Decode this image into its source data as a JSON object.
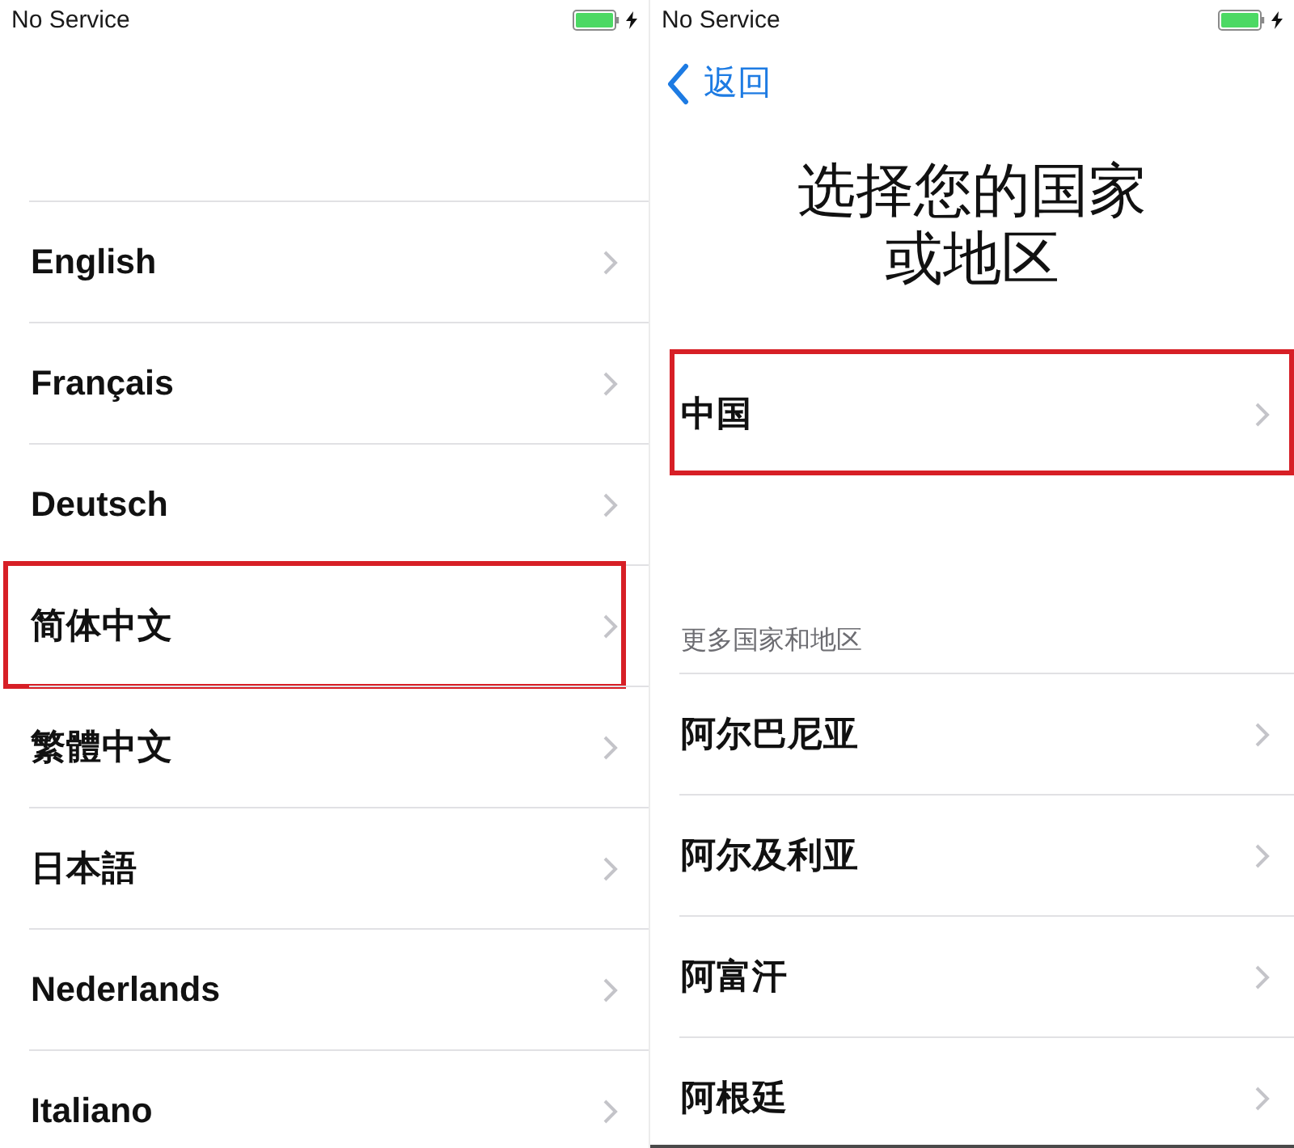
{
  "language_screen": {
    "status_bar": {
      "carrier": "No Service"
    },
    "languages": [
      {
        "label": "English",
        "highlighted": false
      },
      {
        "label": "Français",
        "highlighted": false
      },
      {
        "label": "Deutsch",
        "highlighted": false
      },
      {
        "label": "简体中文",
        "highlighted": true
      },
      {
        "label": "繁體中文",
        "highlighted": false
      },
      {
        "label": "日本語",
        "highlighted": false
      },
      {
        "label": "Nederlands",
        "highlighted": false
      },
      {
        "label": "Italiano",
        "highlighted": false
      }
    ]
  },
  "region_screen": {
    "status_bar": {
      "carrier": "No Service"
    },
    "back_button": {
      "label": "返回"
    },
    "title": "选择您的国家或地区",
    "suggested": [
      {
        "label": "中国",
        "highlighted": true
      }
    ],
    "section_header": "更多国家和地区",
    "regions": [
      {
        "label": "阿尔巴尼亚",
        "highlighted": false
      },
      {
        "label": "阿尔及利亚",
        "highlighted": false
      },
      {
        "label": "阿富汗",
        "highlighted": false
      },
      {
        "label": "阿根廷",
        "highlighted": false
      }
    ]
  }
}
